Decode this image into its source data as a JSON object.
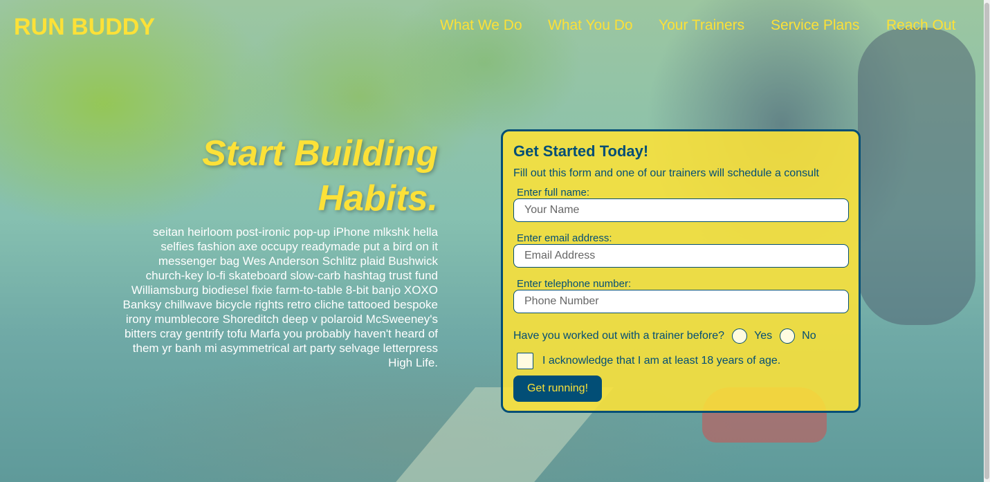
{
  "header": {
    "logo": "RUN BUDDY",
    "nav": [
      {
        "label": "What We Do"
      },
      {
        "label": "What You Do"
      },
      {
        "label": "Your Trainers"
      },
      {
        "label": "Service Plans"
      },
      {
        "label": "Reach Out"
      }
    ]
  },
  "hero": {
    "heading_line1": "Start Building",
    "heading_line2": "Habits.",
    "body": "seitan heirloom post-ironic pop-up iPhone mlkshk hella selfies fashion axe occupy readymade put a bird on it messenger bag Wes Anderson Schlitz plaid Bushwick church-key lo-fi skateboard slow-carb hashtag trust fund Williamsburg biodiesel fixie farm-to-table 8-bit banjo XOXO Banksy chillwave bicycle rights retro cliche tattooed bespoke irony mumblecore Shoreditch deep v polaroid McSweeney's bitters cray gentrify tofu Marfa you probably haven't heard of them yr banh mi asymmetrical art party selvage letterpress High Life."
  },
  "form": {
    "title": "Get Started Today!",
    "subtitle": "Fill out this form and one of our trainers will schedule a consult",
    "name_label": "Enter full name:",
    "name_placeholder": "Your Name",
    "email_label": "Enter email address:",
    "email_placeholder": "Email Address",
    "phone_label": "Enter telephone number:",
    "phone_placeholder": "Phone Number",
    "trainer_question": "Have you worked out with a trainer before?",
    "yes_label": "Yes",
    "no_label": "No",
    "age_ack": "I acknowledge that I am at least 18 years of age.",
    "submit_label": "Get running!"
  },
  "colors": {
    "accent_yellow": "#fce138",
    "dark_blue": "#024e76"
  }
}
